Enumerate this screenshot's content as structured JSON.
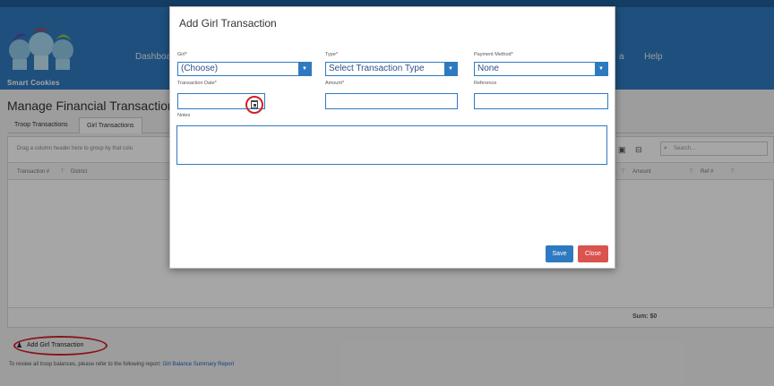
{
  "header": {
    "logo_text": "Smart Cookies",
    "nav": [
      "Dashboa",
      "a",
      "Help"
    ]
  },
  "page": {
    "title": "Manage Financial Transactions",
    "tabs": [
      "Troop Transactions",
      "Girl Transactions"
    ],
    "group_hint": "Drag a column header here to group by that colu",
    "search_placeholder": "Search...",
    "columns": [
      "Transaction #",
      "District",
      "Amount",
      "Ref #"
    ],
    "sum": "Sum: $0",
    "add_button": "Add Girl Transaction",
    "bottom_note": "To review all troop balances, please refer to the following report:",
    "bottom_link": "Girl Balance Summary Report"
  },
  "modal": {
    "title": "Add Girl Transaction",
    "girl_label": "Girl",
    "girl_value": "(Choose)",
    "type_label": "Type",
    "type_value": "Select Transaction Type",
    "payment_label": "Payment Method",
    "payment_value": "None",
    "date_label": "Transaction Date",
    "amount_label": "Amount",
    "reference_label": "Reference",
    "notes_label": "Notes",
    "save": "Save",
    "close": "Close"
  }
}
